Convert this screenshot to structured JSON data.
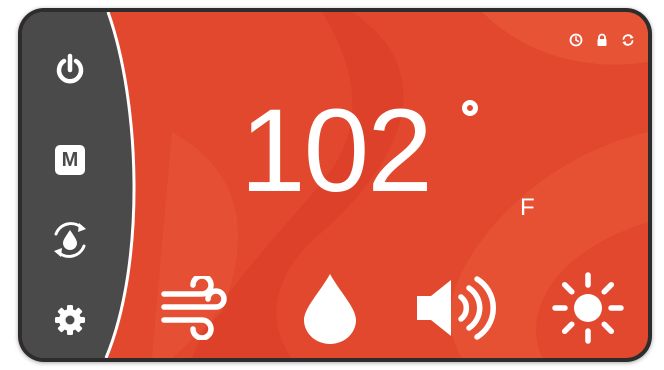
{
  "colors": {
    "accent": "#e2482e",
    "sidebar": "#4a4a4a",
    "icon": "#ffffff"
  },
  "sidebar": {
    "items": [
      {
        "icon": "power-icon"
      },
      {
        "icon": "mode-icon",
        "label": "M"
      },
      {
        "icon": "water-cycle-icon"
      },
      {
        "icon": "gear-icon"
      }
    ]
  },
  "status": {
    "icons": [
      "clock-icon",
      "lock-icon",
      "refresh-icon"
    ]
  },
  "temperature": {
    "value": "102",
    "unit": "F"
  },
  "controls": {
    "icons": [
      "wind-icon",
      "water-drop-icon",
      "speaker-icon",
      "sun-icon"
    ]
  }
}
